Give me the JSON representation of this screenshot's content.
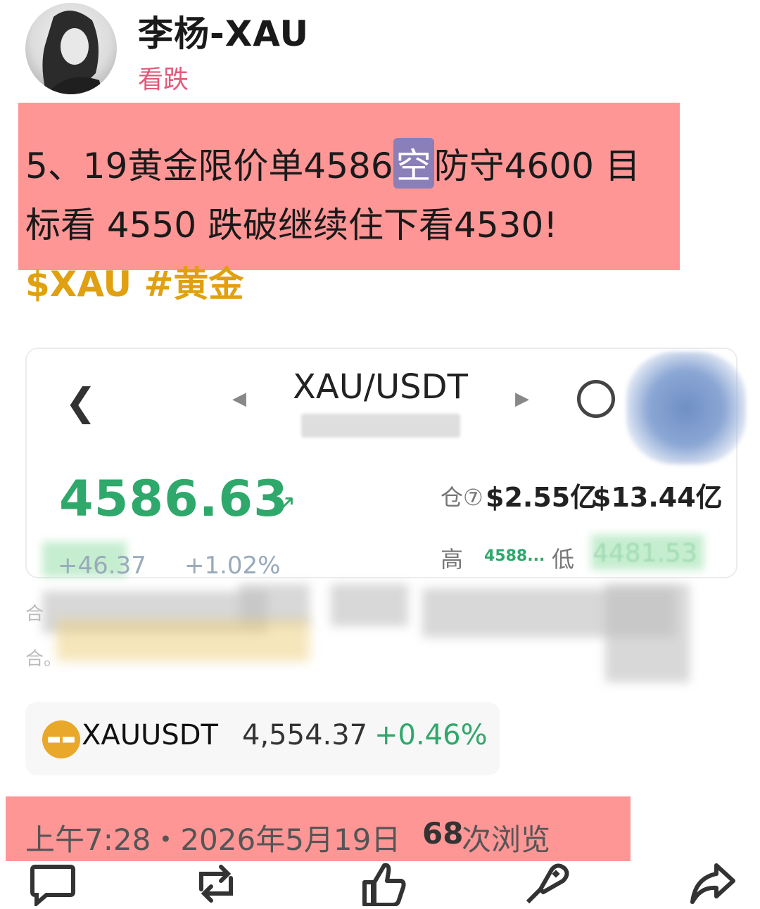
{
  "author": {
    "name": "李杨-XAU",
    "sentiment": "看跌"
  },
  "post": {
    "line1_pre": "5、19黄金限价单4586",
    "line1_short": "空",
    "line1_post": "防守4600 目",
    "line2": "标看  4550 跌破继续住下看4530!",
    "tags": "$XAU #黄金"
  },
  "card": {
    "back_icon": "chevron-left-icon",
    "symbol": "XAU/USDT",
    "price": "4586.63",
    "price_arrow": "↗",
    "position_label": "仓⑦",
    "position_value1": "$2.55亿",
    "position_value2": "$13.44亿",
    "change": "+46.37",
    "change_pct": "+1.02%",
    "high_label": "高",
    "high_value": "4588...",
    "low_label": "低",
    "low_value": "4481.53",
    "info_label1": "合",
    "info_label2": "合。"
  },
  "ticker": {
    "symbol": "XAUUSDT",
    "price": "4,554.37",
    "change": "+0.46%"
  },
  "meta": {
    "time": "上午7:28・2026年5月19日",
    "views_count": "68",
    "views_label": "次浏览"
  },
  "colors": {
    "highlight": "#ff7878",
    "sentiment": "#e05a7a",
    "tag": "#e0a010",
    "up_green": "#2ea86b"
  },
  "actions": [
    "comment-icon",
    "repost-icon",
    "like-icon",
    "tip-icon",
    "share-icon"
  ]
}
